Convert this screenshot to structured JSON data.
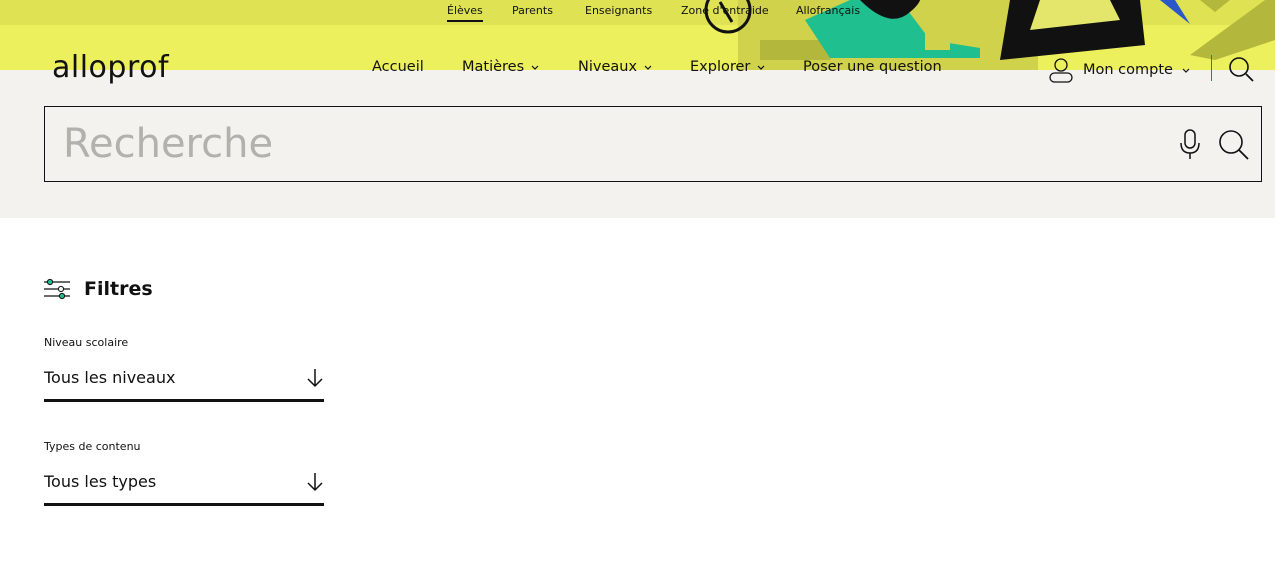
{
  "top_nav": [
    {
      "label": "Élèves",
      "active": true
    },
    {
      "label": "Parents"
    },
    {
      "label": "Enseignants"
    },
    {
      "label": "Zone d'entraide"
    },
    {
      "label": "Allofrançais"
    }
  ],
  "logo": "alloprof",
  "main_nav": {
    "home": "Accueil",
    "subjects": "Matières",
    "levels": "Niveaux",
    "explore": "Explorer",
    "ask": "Poser une question"
  },
  "account": {
    "label": "Mon compte"
  },
  "search": {
    "placeholder": "Recherche"
  },
  "filters": {
    "title": "Filtres",
    "level": {
      "label": "Niveau scolaire",
      "value": "Tous les niveaux"
    },
    "types": {
      "label": "Types de contenu",
      "value": "Tous les types"
    }
  },
  "colors": {
    "yellow": "#ecf05d",
    "yellow_dark": "#dfe353",
    "green": "#1fbf8f",
    "accent": "#1a8b63",
    "background": "#f3f2ee"
  }
}
